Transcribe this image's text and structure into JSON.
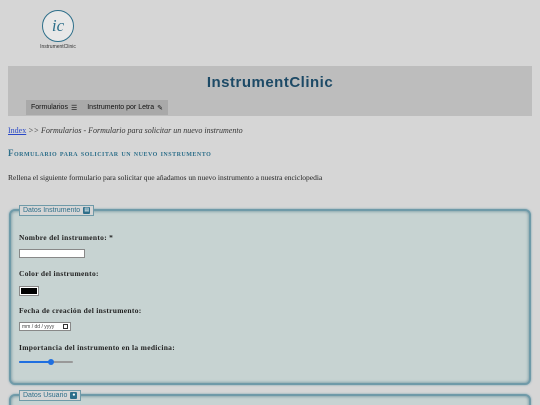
{
  "logo": {
    "monogram": "ic",
    "text": "InstrumentClinic"
  },
  "site_title": "InstrumentClinic",
  "nav": [
    {
      "label": "Formularios",
      "icon": "list-icon"
    },
    {
      "label": "Instrumento por Letra",
      "icon": "pencil-icon"
    }
  ],
  "breadcrumb": {
    "link": "Index",
    "rest": ">> Formularios - Formulario para solicitar un nuevo instrumento"
  },
  "form_title": "Formulario para solicitar un nuevo instrumento",
  "intro": "Rellena el siguiente formulario para solicitar que añadamos un nuevo instrumento a nuestra enciclopedia",
  "fieldsets": [
    {
      "legend": "Datos Instrumento",
      "icon": "clipboard-icon",
      "fields": {
        "name_label": "Nombre del instrumento: *",
        "name_value": "",
        "color_label": "Color del instrumento:",
        "color_value": "#000000",
        "date_label": "Fecha de creación del instrumento:",
        "date_placeholder": "mm / dd / yyyy",
        "importance_label": "Importancia del instrumento en la medicina:",
        "importance_value": 0.6
      }
    },
    {
      "legend": "Datos Usuario",
      "icon": "user-icon"
    }
  ]
}
